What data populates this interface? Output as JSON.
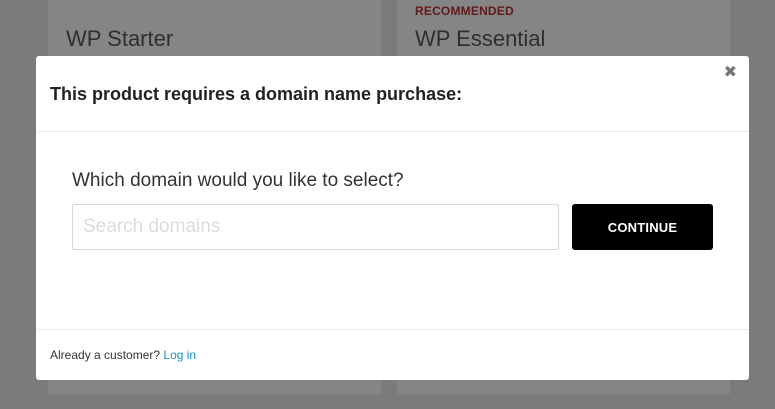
{
  "background": {
    "cards": [
      {
        "badge": "",
        "title": "WP Starter"
      },
      {
        "badge": "RECOMMENDED",
        "title": "WP Essential"
      }
    ]
  },
  "modal": {
    "title": "This product requires a domain name purchase:",
    "close_icon": "close-icon",
    "question": "Which domain would you like to select?",
    "search": {
      "placeholder": "Search domains",
      "value": ""
    },
    "continue_label": "CONTINUE",
    "footer": {
      "prompt": "Already a customer?",
      "login_label": "Log in"
    }
  },
  "colors": {
    "overlay": "#7b7b7b",
    "badge": "#621a1a",
    "button_bg": "#000000",
    "link": "#1a8fc7"
  }
}
